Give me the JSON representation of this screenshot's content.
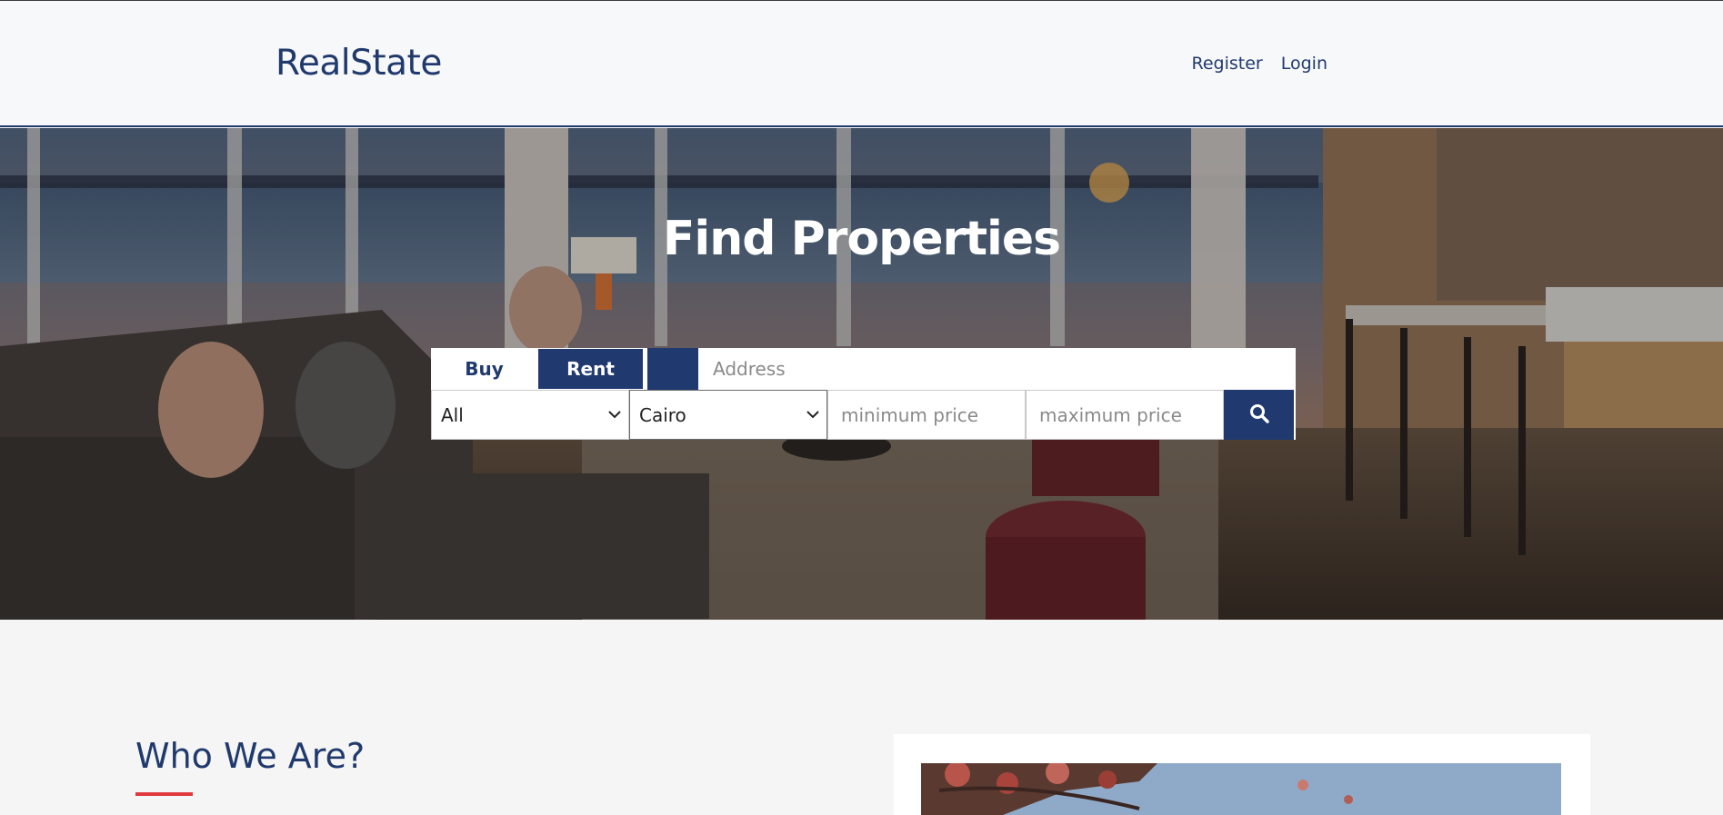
{
  "header": {
    "brand": "RealState",
    "nav": {
      "register": "Register",
      "login": "Login"
    }
  },
  "hero": {
    "title": "Find Properties",
    "tabs": {
      "buy": "Buy",
      "rent": "Rent",
      "active": "Rent"
    },
    "address_placeholder": "Address",
    "type_select": {
      "selected": "All"
    },
    "city_select": {
      "selected": "Cairo"
    },
    "min_price_placeholder": "minimum price",
    "max_price_placeholder": "maximum price"
  },
  "about": {
    "title": "Who We Are?"
  },
  "colors": {
    "primary": "#203a70",
    "accent": "#e03a3e",
    "background": "#f5f5f5"
  },
  "icons": {
    "search": "search-icon",
    "chevron": "chevron-down-icon"
  }
}
